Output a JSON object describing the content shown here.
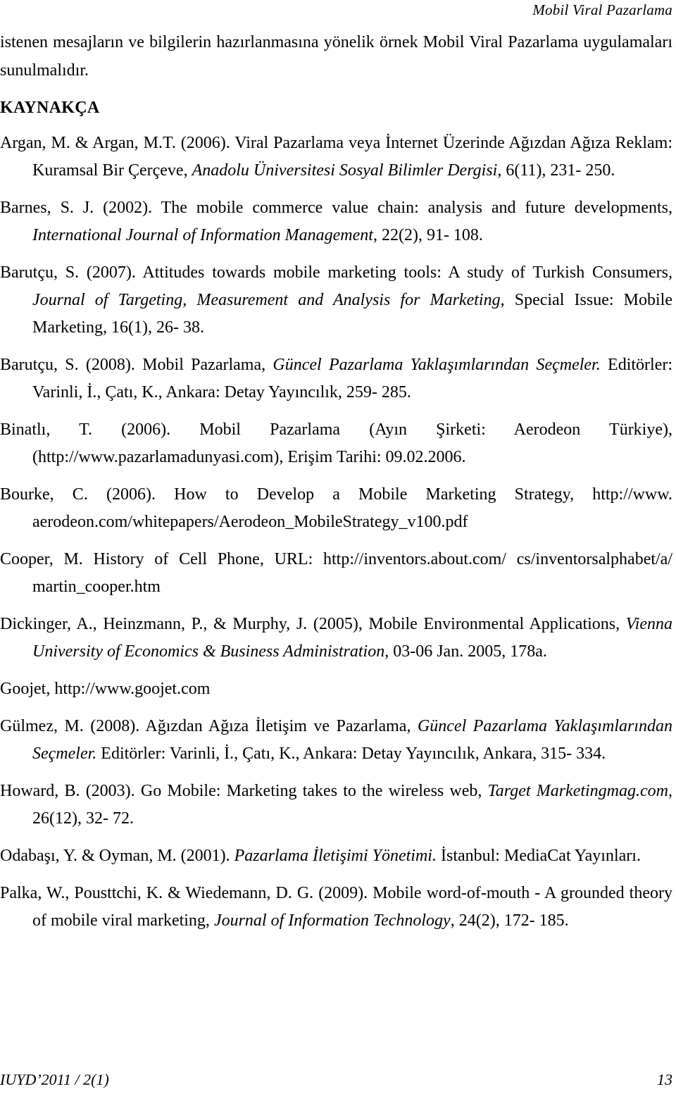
{
  "header": {
    "running_title": "Mobil Viral Pazarlama"
  },
  "body": {
    "continuation_paragraph": "istenen mesajların ve bilgilerin hazırlanmasına yönelik örnek Mobil Viral Pazarlama uygulamaları sunulmalıdır.",
    "references_heading": "KAYNAKÇA"
  },
  "references": [
    {
      "id": "argan-2006",
      "parts": [
        {
          "text": "Argan, M. & Argan, M.T. (2006). Viral Pazarlama veya İnternet Üzerinde Ağızdan Ağıza Reklam: Kuramsal Bir Çerçeve, ",
          "style": "roman"
        },
        {
          "text": "Anadolu Üniversitesi Sosyal Bilimler Dergisi",
          "style": "italic"
        },
        {
          "text": ", 6(11), 231- 250.",
          "style": "roman"
        }
      ]
    },
    {
      "id": "barnes-2002",
      "parts": [
        {
          "text": "Barnes, S. J. (2002). The mobile commerce value chain: analysis and future developments, ",
          "style": "roman"
        },
        {
          "text": "International Journal of Information Management",
          "style": "italic"
        },
        {
          "text": ", 22(2), 91- 108.",
          "style": "roman"
        }
      ]
    },
    {
      "id": "barutcu-2007",
      "parts": [
        {
          "text": "Barutçu, S. (2007). Attitudes towards mobile marketing tools: A study of Turkish Consumers, ",
          "style": "roman"
        },
        {
          "text": "Journal of Targeting, Measurement and Analysis for Marketing",
          "style": "italic"
        },
        {
          "text": ", Special Issue: Mobile Marketing, 16(1), 26- 38.",
          "style": "roman"
        }
      ]
    },
    {
      "id": "barutcu-2008",
      "parts": [
        {
          "text": "Barutçu, S. (2008). Mobil Pazarlama, ",
          "style": "roman"
        },
        {
          "text": "Güncel Pazarlama Yaklaşımlarından Seçmeler.",
          "style": "italic"
        },
        {
          "text": " Editörler: Varinli, İ., Çatı, K., Ankara: Detay Yayıncılık, 259- 285.",
          "style": "roman"
        }
      ]
    },
    {
      "id": "binatli-2006",
      "parts": [
        {
          "text": "Binatlı, T. (2006). Mobil Pazarlama (Ayın Şirketi: Aerodeon Türkiye), (http://www.pazarlamadunyasi.com), Erişim Tarihi: 09.02.2006.",
          "style": "roman"
        }
      ]
    },
    {
      "id": "bourke-2006",
      "parts": [
        {
          "text": "Bourke, C. (2006). How to Develop a Mobile Marketing Strategy, http://www. aerodeon.com/whitepapers/Aerodeon_MobileStrategy_v100.pdf",
          "style": "roman"
        }
      ]
    },
    {
      "id": "cooper",
      "parts": [
        {
          "text": "Cooper, M. History of Cell Phone, URL: http://inventors.about.com/ cs/inventorsalphabet/a/ martin_cooper.htm",
          "style": "roman"
        }
      ]
    },
    {
      "id": "dickinger-2005",
      "parts": [
        {
          "text": "Dickinger, A., Heinzmann, P., & Murphy, J. (2005), Mobile Environmental Applications, ",
          "style": "roman"
        },
        {
          "text": "Vienna University of Economics & Business Administration",
          "style": "italic"
        },
        {
          "text": ", 03-06 Jan. 2005, 178a.",
          "style": "roman"
        }
      ]
    },
    {
      "id": "goojet",
      "parts": [
        {
          "text": "Goojet, http://www.goojet.com",
          "style": "roman"
        }
      ]
    },
    {
      "id": "gulmez-2008",
      "parts": [
        {
          "text": "Gülmez, M. (2008). Ağızdan Ağıza İletişim ve Pazarlama, ",
          "style": "roman"
        },
        {
          "text": "Güncel Pazarlama Yaklaşımlarından Seçmeler.",
          "style": "italic"
        },
        {
          "text": " Editörler: Varinli, İ., Çatı, K., Ankara: Detay Yayıncılık, Ankara, 315- 334.",
          "style": "roman"
        }
      ]
    },
    {
      "id": "howard-2003",
      "parts": [
        {
          "text": "Howard, B. (2003). Go Mobile: Marketing takes to the wireless web, ",
          "style": "roman"
        },
        {
          "text": "Target Marketingmag.com",
          "style": "italic"
        },
        {
          "text": ", 26(12), 32- 72.",
          "style": "roman"
        }
      ]
    },
    {
      "id": "odabasi-2001",
      "parts": [
        {
          "text": "Odabaşı, Y. & Oyman, M. (2001). ",
          "style": "roman"
        },
        {
          "text": "Pazarlama İletişimi Yönetimi.",
          "style": "italic"
        },
        {
          "text": " İstanbul: MediaCat Yayınları.",
          "style": "roman"
        }
      ]
    },
    {
      "id": "palka-2009",
      "parts": [
        {
          "text": "Palka, W., Pousttchi, K. & Wiedemann, D. G. (2009). Mobile word-of-mouth - A grounded theory of mobile viral marketing,  ",
          "style": "roman"
        },
        {
          "text": "Journal of Information Technology",
          "style": "italic"
        },
        {
          "text": ", 24(2), 172- 185.",
          "style": "roman"
        }
      ]
    }
  ],
  "footer": {
    "journal_issue": "IUYD’2011 / 2(1)",
    "page_number": "13"
  }
}
